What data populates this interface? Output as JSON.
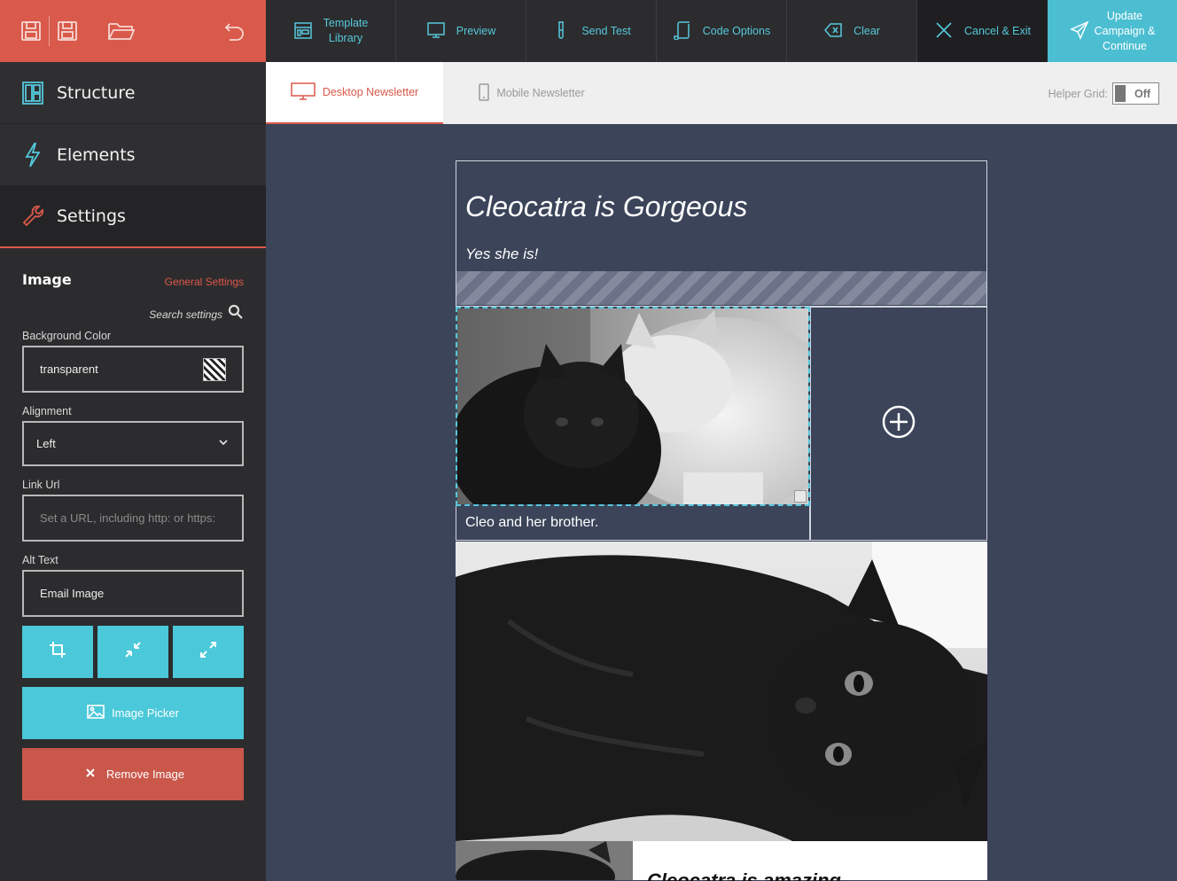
{
  "toolbar": {
    "template_library": "Template\nLibrary",
    "preview": "Preview",
    "send_test": "Send Test",
    "code_options": "Code Options",
    "clear": "Clear",
    "cancel_exit": "Cancel & Exit",
    "update_campaign": "Update\nCampaign &\nContinue"
  },
  "sidebar": {
    "panels": [
      {
        "label": "Structure",
        "icon": "layout-icon"
      },
      {
        "label": "Elements",
        "icon": "lightning-icon"
      },
      {
        "label": "Settings",
        "icon": "wrench-icon"
      }
    ],
    "settings": {
      "title": "Image",
      "general_link": "General Settings",
      "search_label": "Search settings",
      "background_color_label": "Background Color",
      "background_color_value": "transparent",
      "alignment_label": "Alignment",
      "alignment_value": "Left",
      "link_url_label": "Link Url",
      "link_url_placeholder": "Set a URL, including http: or https:",
      "alt_text_label": "Alt Text",
      "alt_text_value": "Email Image",
      "image_picker": "Image Picker",
      "remove_image": "Remove Image"
    }
  },
  "view_tabs": {
    "desktop": "Desktop Newsletter",
    "mobile": "Mobile Newsletter",
    "helper_grid_label": "Helper Grid:",
    "helper_grid_state": "Off"
  },
  "email": {
    "title": "Cleocatra is Gorgeous",
    "subtitle": "Yes she is!",
    "caption": "Cleo and her brother.",
    "section_title": "Cleocatra is amazing"
  },
  "colors": {
    "accent_red": "#d9594a",
    "accent_cyan": "#4bc8d9",
    "canvas": "#3b4459",
    "sidebar": "#2c2c2e"
  }
}
